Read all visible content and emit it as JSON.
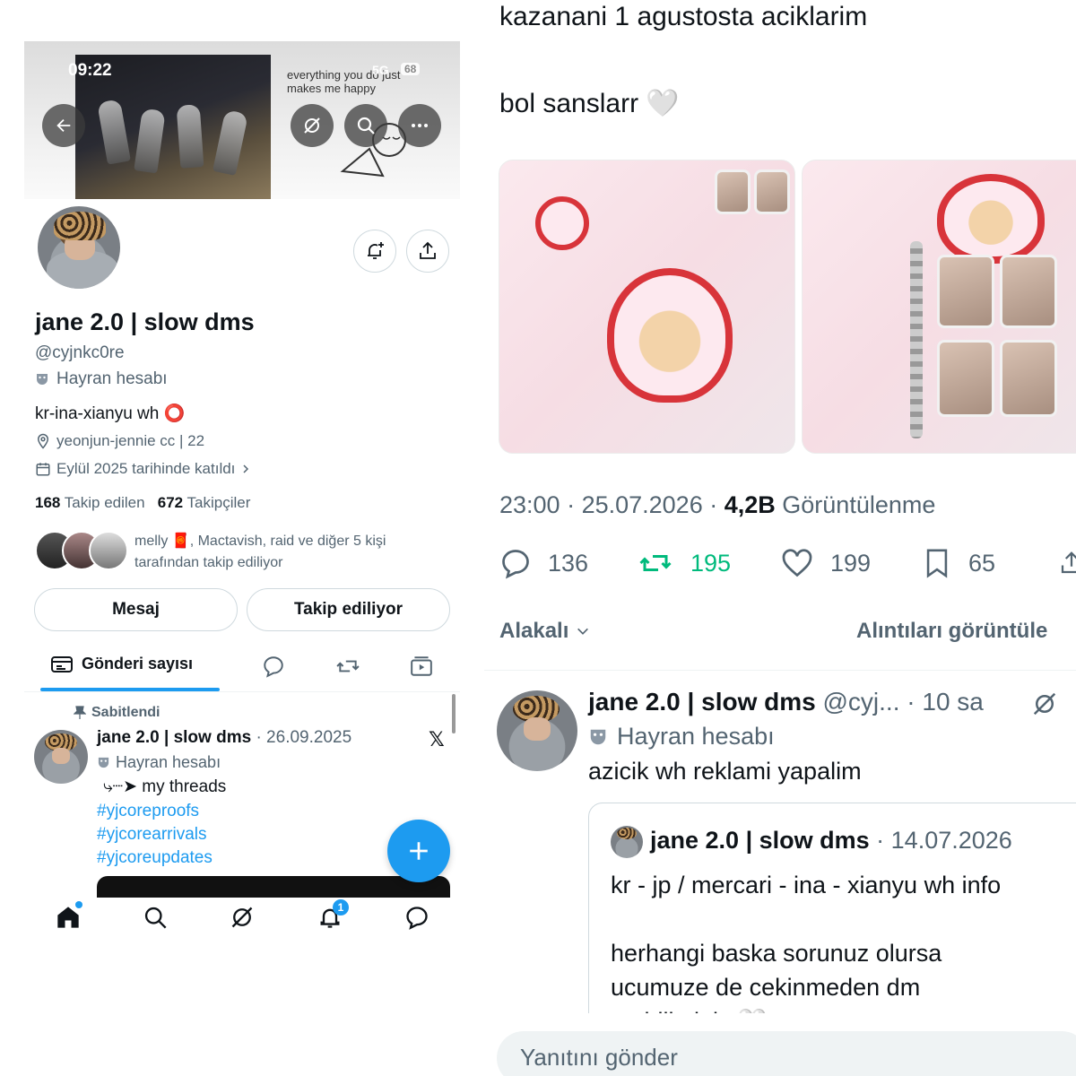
{
  "left": {
    "status": {
      "time": "09:22",
      "network": "5G",
      "battery": "68"
    },
    "banner_text": "everything you do just makes me happy",
    "profile": {
      "name": "jane 2.0 | slow dms",
      "handle": "@cyjnkc0re",
      "badge": "Hayran hesabı",
      "bio": "kr-ina-xianyu wh ⭕",
      "location": "yeonjun-jennie cc | 22",
      "joined": "Eylül 2025 tarihinde katıldı",
      "following_count": "168",
      "following_label": "Takip edilen",
      "followers_count": "672",
      "followers_label": "Takipçiler",
      "followed_by_line1": "melly 🧧, Mactavish, raid ve diğer 5 kişi",
      "followed_by_line2": "tarafından takip ediliyor"
    },
    "buttons": {
      "message": "Mesaj",
      "following": "Takip ediliyor"
    },
    "tabs": {
      "posts": "Gönderi sayısı"
    },
    "pinned_post": {
      "pinned_label": "Sabitlendi",
      "name": "jane 2.0 | slow dms",
      "date": "· 26.09.2025",
      "badge": "Hayran hesabı",
      "line1": "⤷┈➤ my threads",
      "tags": [
        "#yjcoreproofs",
        "#yjcorearrivals",
        "#yjcoreupdates"
      ]
    },
    "nav": {
      "notifications_badge": "1"
    }
  },
  "right": {
    "tweet_text_1": "kazanani 1 agustosta aciklarim",
    "tweet_text_2": "bol sanslarr 🤍",
    "meta": {
      "time": "23:00",
      "date": "25.07.2026",
      "views_count": "4,2B",
      "views_label": "Görüntülenme"
    },
    "stats": {
      "replies": "136",
      "retweets": "195",
      "likes": "199",
      "bookmarks": "65"
    },
    "sort": {
      "relevant": "Alakalı",
      "quotes": "Alıntıları görüntüle"
    },
    "reply": {
      "name": "jane 2.0 | slow dms",
      "handle_time": "@cyj... · 10 sa",
      "badge": "Hayran hesabı",
      "text": "azicik wh reklami yapalim"
    },
    "quote": {
      "name": "jane 2.0 | slow dms",
      "date": "· 14.07.2026",
      "line1": "kr - jp / mercari - ina - xianyu wh info",
      "line2": "herhangi baska sorunuz olursa",
      "line3": "ucumuze de cekinmeden dm",
      "line4": "atabilirsiniz 🤍"
    },
    "reply_placeholder": "Yanıtını gönder"
  }
}
